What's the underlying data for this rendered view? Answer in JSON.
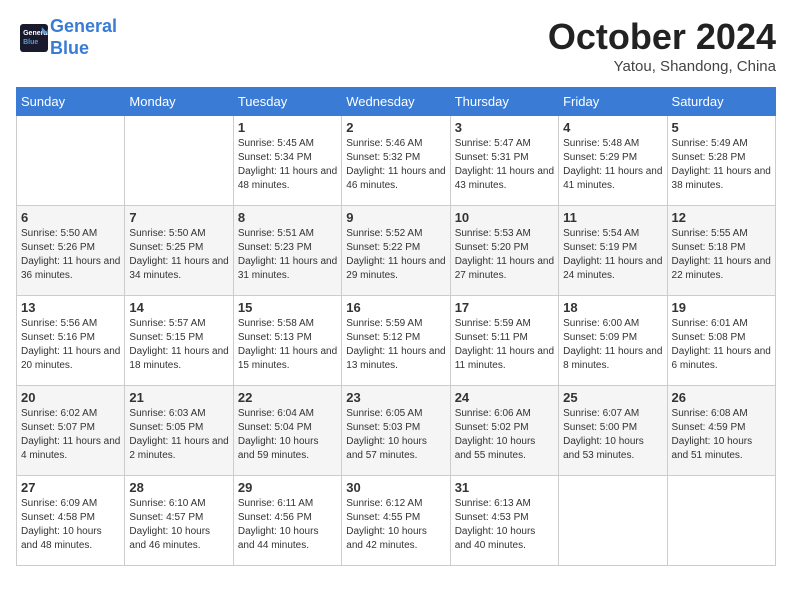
{
  "header": {
    "logo_line1": "General",
    "logo_line2": "Blue",
    "month": "October 2024",
    "location": "Yatou, Shandong, China"
  },
  "days_of_week": [
    "Sunday",
    "Monday",
    "Tuesday",
    "Wednesday",
    "Thursday",
    "Friday",
    "Saturday"
  ],
  "weeks": [
    [
      {
        "day": "",
        "info": ""
      },
      {
        "day": "",
        "info": ""
      },
      {
        "day": "1",
        "info": "Sunrise: 5:45 AM\nSunset: 5:34 PM\nDaylight: 11 hours and 48 minutes."
      },
      {
        "day": "2",
        "info": "Sunrise: 5:46 AM\nSunset: 5:32 PM\nDaylight: 11 hours and 46 minutes."
      },
      {
        "day": "3",
        "info": "Sunrise: 5:47 AM\nSunset: 5:31 PM\nDaylight: 11 hours and 43 minutes."
      },
      {
        "day": "4",
        "info": "Sunrise: 5:48 AM\nSunset: 5:29 PM\nDaylight: 11 hours and 41 minutes."
      },
      {
        "day": "5",
        "info": "Sunrise: 5:49 AM\nSunset: 5:28 PM\nDaylight: 11 hours and 38 minutes."
      }
    ],
    [
      {
        "day": "6",
        "info": "Sunrise: 5:50 AM\nSunset: 5:26 PM\nDaylight: 11 hours and 36 minutes."
      },
      {
        "day": "7",
        "info": "Sunrise: 5:50 AM\nSunset: 5:25 PM\nDaylight: 11 hours and 34 minutes."
      },
      {
        "day": "8",
        "info": "Sunrise: 5:51 AM\nSunset: 5:23 PM\nDaylight: 11 hours and 31 minutes."
      },
      {
        "day": "9",
        "info": "Sunrise: 5:52 AM\nSunset: 5:22 PM\nDaylight: 11 hours and 29 minutes."
      },
      {
        "day": "10",
        "info": "Sunrise: 5:53 AM\nSunset: 5:20 PM\nDaylight: 11 hours and 27 minutes."
      },
      {
        "day": "11",
        "info": "Sunrise: 5:54 AM\nSunset: 5:19 PM\nDaylight: 11 hours and 24 minutes."
      },
      {
        "day": "12",
        "info": "Sunrise: 5:55 AM\nSunset: 5:18 PM\nDaylight: 11 hours and 22 minutes."
      }
    ],
    [
      {
        "day": "13",
        "info": "Sunrise: 5:56 AM\nSunset: 5:16 PM\nDaylight: 11 hours and 20 minutes."
      },
      {
        "day": "14",
        "info": "Sunrise: 5:57 AM\nSunset: 5:15 PM\nDaylight: 11 hours and 18 minutes."
      },
      {
        "day": "15",
        "info": "Sunrise: 5:58 AM\nSunset: 5:13 PM\nDaylight: 11 hours and 15 minutes."
      },
      {
        "day": "16",
        "info": "Sunrise: 5:59 AM\nSunset: 5:12 PM\nDaylight: 11 hours and 13 minutes."
      },
      {
        "day": "17",
        "info": "Sunrise: 5:59 AM\nSunset: 5:11 PM\nDaylight: 11 hours and 11 minutes."
      },
      {
        "day": "18",
        "info": "Sunrise: 6:00 AM\nSunset: 5:09 PM\nDaylight: 11 hours and 8 minutes."
      },
      {
        "day": "19",
        "info": "Sunrise: 6:01 AM\nSunset: 5:08 PM\nDaylight: 11 hours and 6 minutes."
      }
    ],
    [
      {
        "day": "20",
        "info": "Sunrise: 6:02 AM\nSunset: 5:07 PM\nDaylight: 11 hours and 4 minutes."
      },
      {
        "day": "21",
        "info": "Sunrise: 6:03 AM\nSunset: 5:05 PM\nDaylight: 11 hours and 2 minutes."
      },
      {
        "day": "22",
        "info": "Sunrise: 6:04 AM\nSunset: 5:04 PM\nDaylight: 10 hours and 59 minutes."
      },
      {
        "day": "23",
        "info": "Sunrise: 6:05 AM\nSunset: 5:03 PM\nDaylight: 10 hours and 57 minutes."
      },
      {
        "day": "24",
        "info": "Sunrise: 6:06 AM\nSunset: 5:02 PM\nDaylight: 10 hours and 55 minutes."
      },
      {
        "day": "25",
        "info": "Sunrise: 6:07 AM\nSunset: 5:00 PM\nDaylight: 10 hours and 53 minutes."
      },
      {
        "day": "26",
        "info": "Sunrise: 6:08 AM\nSunset: 4:59 PM\nDaylight: 10 hours and 51 minutes."
      }
    ],
    [
      {
        "day": "27",
        "info": "Sunrise: 6:09 AM\nSunset: 4:58 PM\nDaylight: 10 hours and 48 minutes."
      },
      {
        "day": "28",
        "info": "Sunrise: 6:10 AM\nSunset: 4:57 PM\nDaylight: 10 hours and 46 minutes."
      },
      {
        "day": "29",
        "info": "Sunrise: 6:11 AM\nSunset: 4:56 PM\nDaylight: 10 hours and 44 minutes."
      },
      {
        "day": "30",
        "info": "Sunrise: 6:12 AM\nSunset: 4:55 PM\nDaylight: 10 hours and 42 minutes."
      },
      {
        "day": "31",
        "info": "Sunrise: 6:13 AM\nSunset: 4:53 PM\nDaylight: 10 hours and 40 minutes."
      },
      {
        "day": "",
        "info": ""
      },
      {
        "day": "",
        "info": ""
      }
    ]
  ]
}
